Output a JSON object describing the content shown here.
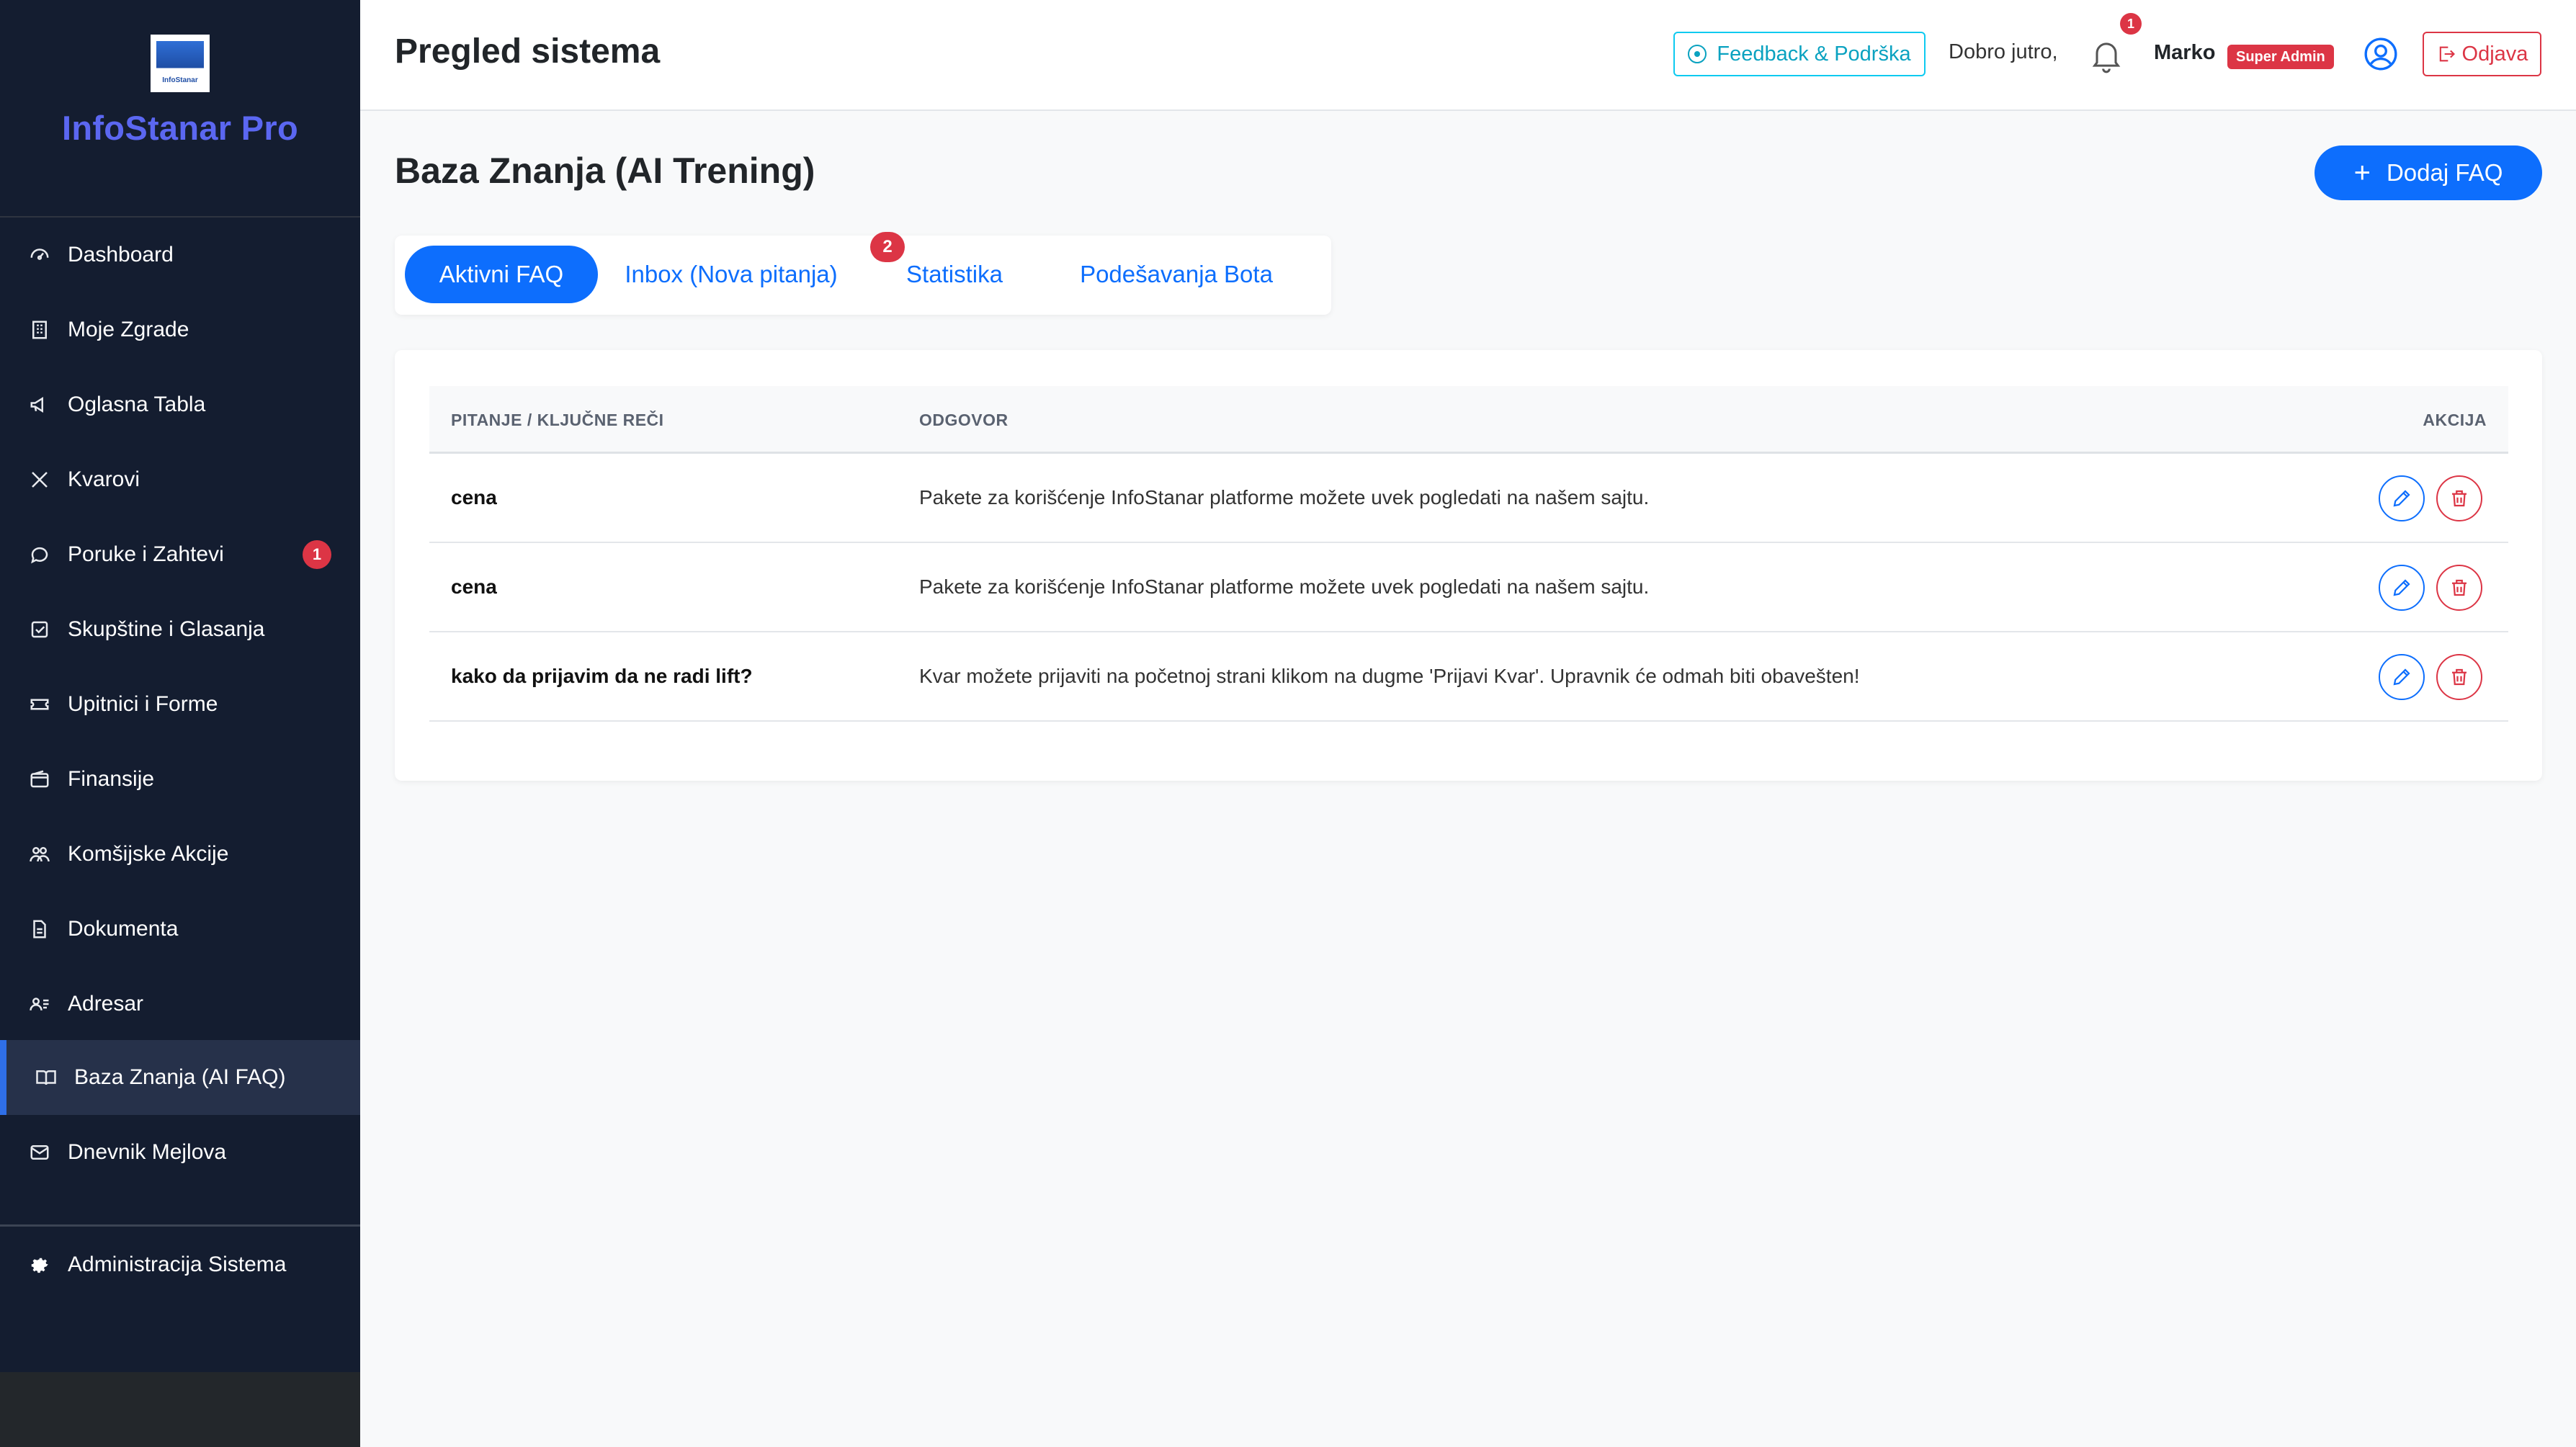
{
  "sidebar": {
    "brand": "InfoStanar Pro",
    "logo_text": "InfoStanar",
    "items": [
      {
        "label": "Dashboard",
        "icon": "dashboard-icon"
      },
      {
        "label": "Moje Zgrade",
        "icon": "building-icon"
      },
      {
        "label": "Oglasna Tabla",
        "icon": "megaphone-icon"
      },
      {
        "label": "Kvarovi",
        "icon": "tools-icon"
      },
      {
        "label": "Poruke i Zahtevi",
        "icon": "chat-icon",
        "badge": "1"
      },
      {
        "label": "Skupštine i Glasanja",
        "icon": "check-square-icon"
      },
      {
        "label": "Upitnici i Forme",
        "icon": "ticket-icon"
      },
      {
        "label": "Finansije",
        "icon": "wallet-icon"
      },
      {
        "label": "Komšijske Akcije",
        "icon": "people-icon"
      },
      {
        "label": "Dokumenta",
        "icon": "document-icon"
      },
      {
        "label": "Adresar",
        "icon": "contacts-icon"
      },
      {
        "label": "Baza Znanja (AI FAQ)",
        "icon": "book-icon",
        "active": true
      },
      {
        "label": "Dnevnik Mejlova",
        "icon": "mail-icon"
      }
    ],
    "admin": {
      "label": "Administracija Sistema",
      "icon": "gear-icon"
    }
  },
  "topbar": {
    "title": "Pregled sistema",
    "feedback": "Feedback & Podrška",
    "greeting": "Dobro jutro,",
    "notifications": "1",
    "user": "Marko",
    "role": "Super Admin",
    "logout": "Odjava"
  },
  "main": {
    "title": "Baza Znanja (AI Trening)",
    "add_button": "Dodaj FAQ",
    "tabs": [
      {
        "label": "Aktivni FAQ",
        "active": true
      },
      {
        "label": "Inbox (Nova pitanja)",
        "badge": "2"
      },
      {
        "label": "Statistika"
      },
      {
        "label": "Podešavanja Bota"
      }
    ],
    "table": {
      "headers": [
        "PITANJE / KLJUČNE REČI",
        "ODGOVOR",
        "AKCIJA"
      ],
      "rows": [
        {
          "question": "cena",
          "answer": "Pakete za korišćenje InfoStanar platforme možete uvek pogledati na našem sajtu."
        },
        {
          "question": "cena",
          "answer": "Pakete za korišćenje InfoStanar platforme možete uvek pogledati na našem sajtu."
        },
        {
          "question": "kako da prijavim da ne radi lift?",
          "answer": "Kvar možete prijaviti na početnoj strani klikom na dugme 'Prijavi Kvar'. Upravnik će odmah biti obavešten!"
        }
      ]
    }
  },
  "colors": {
    "primary": "#0d6efd",
    "danger": "#dc3545",
    "info": "#0dcaf0",
    "sidebar_bg": "#141d30",
    "brand": "#5b67f1"
  }
}
